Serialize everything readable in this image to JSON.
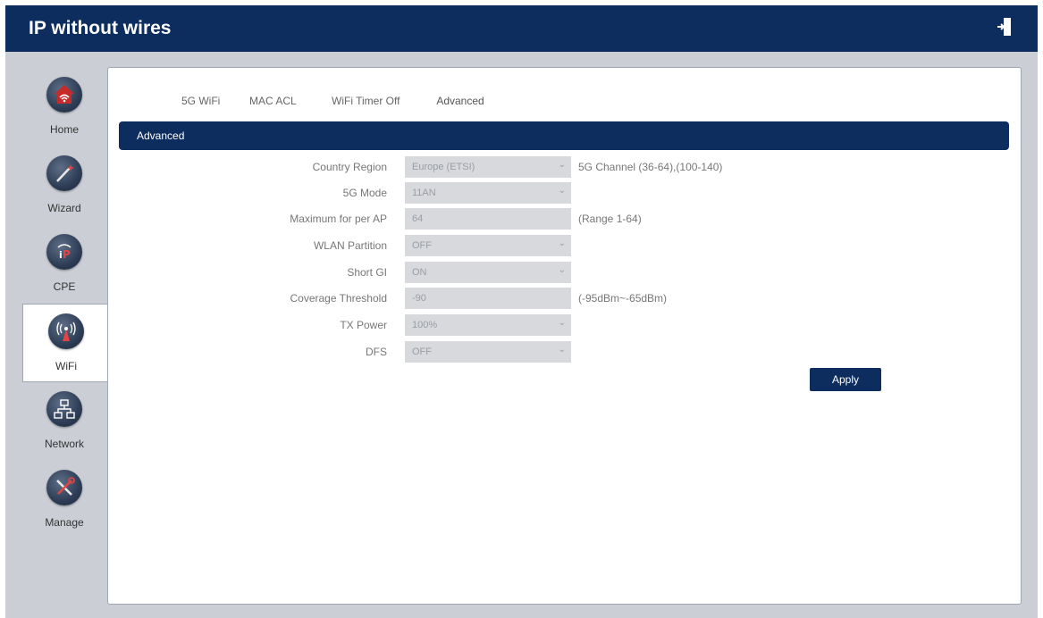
{
  "header": {
    "title": "IP without wires",
    "logout_icon": "logout-icon"
  },
  "sidebar": {
    "items": [
      {
        "label": "Home",
        "icon": "wifi-house-icon"
      },
      {
        "label": "Wizard",
        "icon": "magic-wand-icon"
      },
      {
        "label": "CPE",
        "icon": "ip-mitter-icon"
      },
      {
        "label": "WiFi",
        "icon": "antenna-icon",
        "active": true
      },
      {
        "label": "Network",
        "icon": "network-icon"
      },
      {
        "label": "Manage",
        "icon": "tools-icon"
      }
    ]
  },
  "tabs": [
    {
      "label": "5G WiFi"
    },
    {
      "label": "MAC ACL"
    },
    {
      "label": "WiFi Timer Off"
    },
    {
      "label": "Advanced",
      "active": true
    }
  ],
  "section": {
    "title": "Advanced"
  },
  "form": {
    "country_region": {
      "label": "Country Region",
      "value": "Europe (ETSI)",
      "hint": "5G Channel (36-64),(100-140)"
    },
    "mode_5g": {
      "label": "5G Mode",
      "value": "11AN"
    },
    "max_per_ap": {
      "label": "Maximum for per AP",
      "value": "64",
      "hint": "(Range 1-64)"
    },
    "wlan_partition": {
      "label": "WLAN Partition",
      "value": "OFF"
    },
    "short_gi": {
      "label": "Short GI",
      "value": "ON"
    },
    "coverage_threshold": {
      "label": "Coverage Threshold",
      "value": "-90",
      "hint": "(-95dBm~-65dBm)"
    },
    "tx_power": {
      "label": "TX Power",
      "value": "100%"
    },
    "dfs": {
      "label": "DFS",
      "value": "OFF"
    }
  },
  "actions": {
    "apply_label": "Apply"
  },
  "colors": {
    "navy": "#0d2d5e",
    "tab_accent": "#d62631",
    "frame": "#cbcfd5"
  }
}
